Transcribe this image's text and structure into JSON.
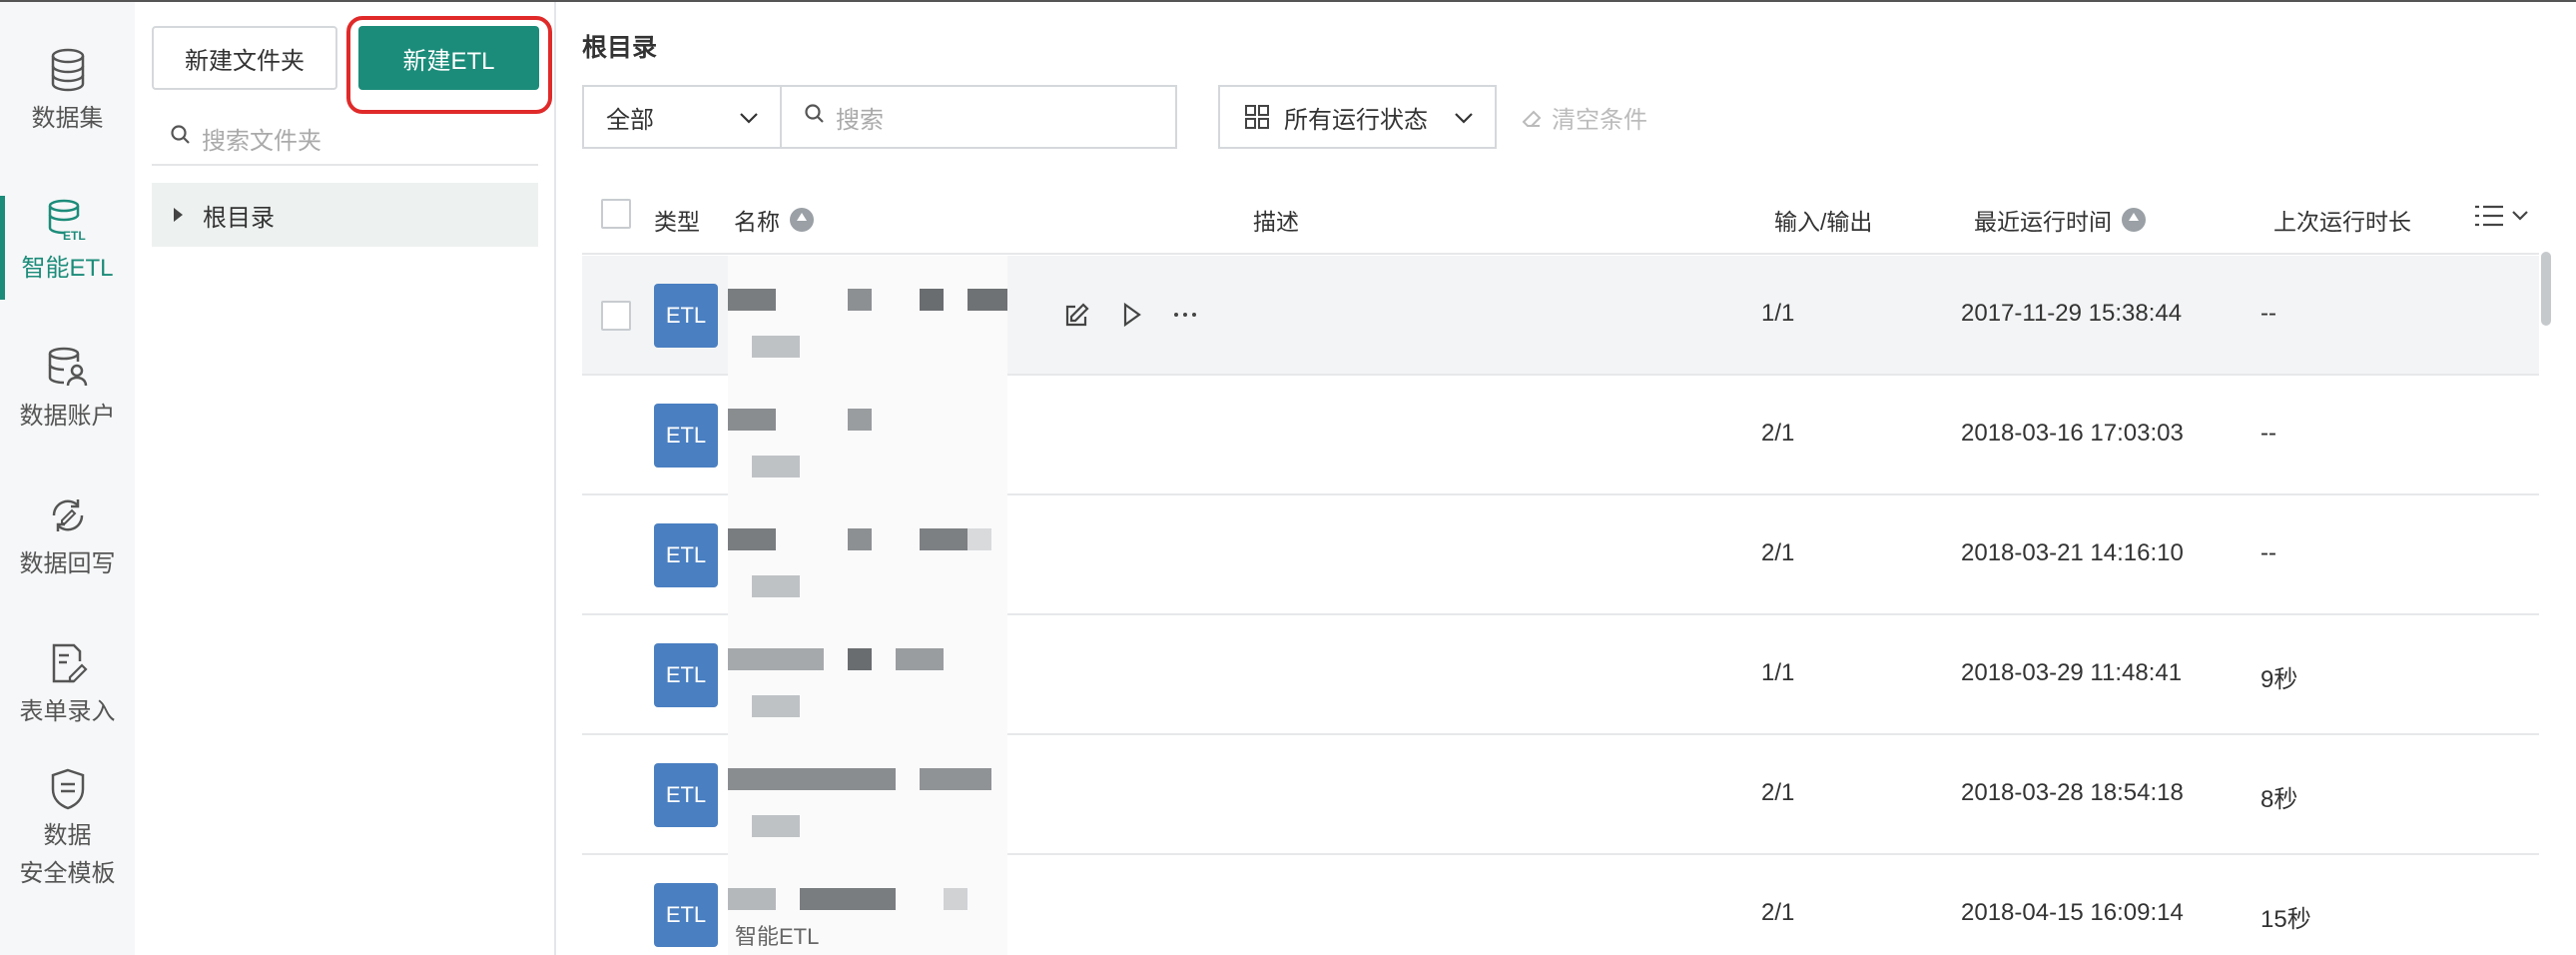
{
  "nav": {
    "items": [
      {
        "label": "数据集",
        "icon": "database-icon",
        "active": false
      },
      {
        "label": "智能ETL",
        "icon": "etl-database-icon",
        "active": true
      },
      {
        "label": "数据账户",
        "icon": "database-user-icon",
        "active": false
      },
      {
        "label": "数据回写",
        "icon": "sync-write-icon",
        "active": false
      },
      {
        "label": "表单录入",
        "icon": "form-edit-icon",
        "active": false
      },
      {
        "label1": "数据",
        "label2": "安全模板",
        "icon": "shield-document-icon",
        "active": false
      }
    ]
  },
  "folder_panel": {
    "new_folder_label": "新建文件夹",
    "new_etl_label": "新建ETL",
    "search_placeholder": "搜索文件夹",
    "tree_root": "根目录"
  },
  "main": {
    "title": "根目录",
    "filter_type_value": "全部",
    "search_placeholder": "搜索",
    "status_filter_value": "所有运行状态",
    "clear_label": "清空条件"
  },
  "table": {
    "headers": {
      "type": "类型",
      "name": "名称",
      "description": "描述",
      "io": "输入/输出",
      "last_run_time": "最近运行时间",
      "last_duration": "上次运行时长"
    },
    "rows": [
      {
        "type_badge": "ETL",
        "io": "1/1",
        "last_run_time": "2017-11-29 15:38:44",
        "duration": "--"
      },
      {
        "type_badge": "ETL",
        "io": "2/1",
        "last_run_time": "2018-03-16 17:03:03",
        "duration": "--"
      },
      {
        "type_badge": "ETL",
        "io": "2/1",
        "last_run_time": "2018-03-21 14:16:10",
        "duration": "--"
      },
      {
        "type_badge": "ETL",
        "io": "1/1",
        "last_run_time": "2018-03-29 11:48:41",
        "duration": "9秒"
      },
      {
        "type_badge": "ETL",
        "io": "2/1",
        "last_run_time": "2018-03-28 18:54:18",
        "duration": "8秒"
      },
      {
        "type_badge": "ETL",
        "io": "2/1",
        "last_run_time": "2018-04-15 16:09:14",
        "duration": "15秒",
        "sub_text": "智能ETL"
      }
    ]
  },
  "colors": {
    "accent": "#1c8c7a",
    "etl_badge": "#4a7fc1",
    "highlight": "#e02a2a"
  }
}
